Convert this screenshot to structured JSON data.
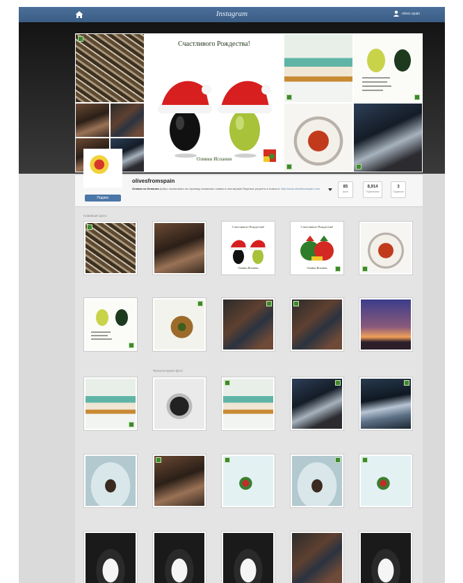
{
  "topbar": {
    "brand": "Instagram",
    "username": "olives spain",
    "home_icon": "home-icon",
    "user_icon": "user-icon"
  },
  "cover": {
    "card_title": "Счастливого Рождества!",
    "card_bottom": "Оливки Испании",
    "olive_card_title": "Оливки из Испании"
  },
  "profile": {
    "username": "olivesfromspain",
    "bio_name": "Оливки из Испании",
    "bio_text": "Добро пожаловать на страницу испанских оливок в инстаграме! Вкусные рецепты и новости.",
    "bio_link": "http://www.olivesfromspain.com",
    "follow_label": "Подпис",
    "stats": [
      {
        "num": "85",
        "label": "фото"
      },
      {
        "num": "8,914",
        "label": "Подписчики"
      },
      {
        "num": "3",
        "label": "Подписки"
      }
    ]
  },
  "feed": {
    "section_1": "Новейшие фото",
    "section_2": "Прошлогодние фото",
    "rows": [
      [
        "pretzels",
        "restaurant",
        "xmas-olives",
        "xmas-hens",
        "plate"
      ],
      [
        "olive-card",
        "spoon",
        "crowd",
        "crowd",
        "night"
      ],
      [
        "tapas",
        "pot",
        "tapas",
        "cook",
        "noodles"
      ],
      [
        "dish-flat",
        "restaurant",
        "garnish",
        "dish-flat",
        "garnish"
      ],
      [
        "event",
        "event",
        "event",
        "crowd",
        "event"
      ]
    ]
  },
  "colors": {
    "topbar": "#3b5d86",
    "follow": "#4b76a8",
    "badge": "#3d8a2c"
  }
}
